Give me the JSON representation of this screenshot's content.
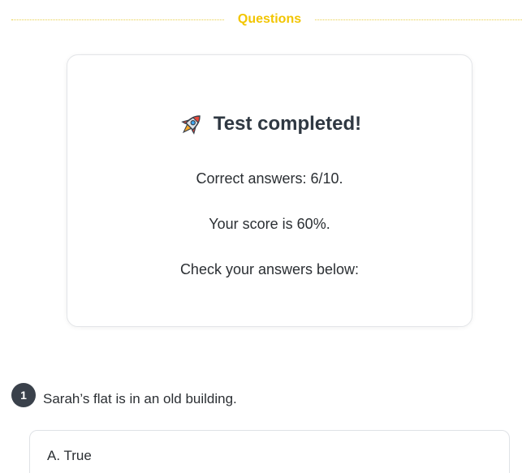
{
  "section": {
    "title": "Questions"
  },
  "result": {
    "icon": "rocket-icon",
    "heading": "Test completed!",
    "correct_answers": "Correct answers: 6/10.",
    "score": "Your score is 60%.",
    "check": "Check your answers below:"
  },
  "questions": [
    {
      "number": "1",
      "text": "Sarah’s flat is in an old building.",
      "options": [
        {
          "label": "A. True"
        }
      ]
    }
  ],
  "colors": {
    "accent": "#f2c500",
    "badge_bg": "#3a414b",
    "heading": "#2f3842",
    "text": "#2b2f33",
    "border": "#dfe2e6"
  }
}
